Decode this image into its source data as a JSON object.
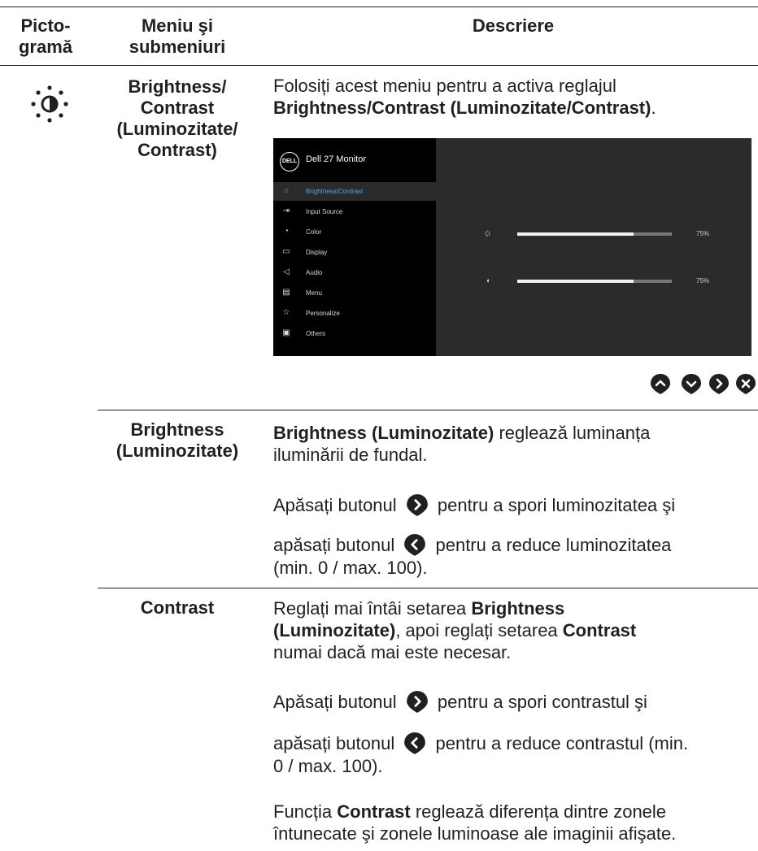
{
  "header": {
    "col1": "Picto-\ngramă",
    "col2": "Meniu şi\nsubmeniuri",
    "col3": "Descriere"
  },
  "row1": {
    "icon": "brightness-contrast-icon",
    "label": "Brightness/\nContrast\n(Luminozitate/\nContrast)",
    "desc_plain": "Folosiți acest meniu pentru a activa reglajul",
    "desc_bold": "Brightness/Contrast (Luminozitate/Contrast)",
    "desc_end": "."
  },
  "osd": {
    "title": "Dell 27 Monitor",
    "logo_text": "DELL",
    "menu_items": [
      {
        "label": "Brightness/Contrast",
        "icon": "sun-icon",
        "glyph": "☼"
      },
      {
        "label": "Input Source",
        "icon": "input-source-icon",
        "glyph": "⇥"
      },
      {
        "label": "Color",
        "icon": "color-icon",
        "glyph": "◔"
      },
      {
        "label": "Display",
        "icon": "display-icon",
        "glyph": "▭"
      },
      {
        "label": "Audio",
        "icon": "audio-icon",
        "glyph": "◁"
      },
      {
        "label": "Menu",
        "icon": "menu-icon",
        "glyph": "▤"
      },
      {
        "label": "Personalize",
        "icon": "star-icon",
        "glyph": "☆"
      },
      {
        "label": "Others",
        "icon": "others-icon",
        "glyph": "▣"
      }
    ],
    "brightness": {
      "value": 0.75,
      "text": "75%"
    },
    "contrast": {
      "value": 0.75,
      "text": "75%"
    },
    "colors": {
      "active": "#56a0e6",
      "panel": "#2b2b2b",
      "sidebar": "#000000"
    }
  },
  "nav_buttons": [
    "up-icon",
    "down-icon",
    "right-icon",
    "close-icon"
  ],
  "row2": {
    "label": "Brightness\n(Luminozitate)",
    "p1_bold": "Brightness (Luminozitate)",
    "p1_plain": " reglează luminanța",
    "p1_line2": "iluminării de fundal.",
    "p2a": "Apăsați butonul",
    "p2b": "pentru a spori luminozitatea şi",
    "p3a": "apăsați butonul",
    "p3b": "pentru a reduce luminozitatea",
    "p3c": "(min. 0 / max. 100)."
  },
  "row3": {
    "label": "Contrast",
    "l1_plain": "Reglați mai întâi setarea ",
    "l1_bold": "Brightness",
    "l2_bold": "(Luminozitate)",
    "l2_plain": ", apoi reglați setarea ",
    "l2_bold2": "Contrast",
    "l3": "numai dacă mai este necesar.",
    "p2a": "Apăsați butonul",
    "p2b": "pentru a spori contrastul şi",
    "p3a": "apăsați butonul",
    "p3b": "pentru a reduce contrastul (min.",
    "p3c": "0 / max. 100).",
    "p4_plain1": "Funcția ",
    "p4_bold": "Contrast",
    "p4_plain2": " reglează diferența dintre zonele",
    "p4_line2": "întunecate şi zonele luminoase ale imaginii afişate."
  }
}
